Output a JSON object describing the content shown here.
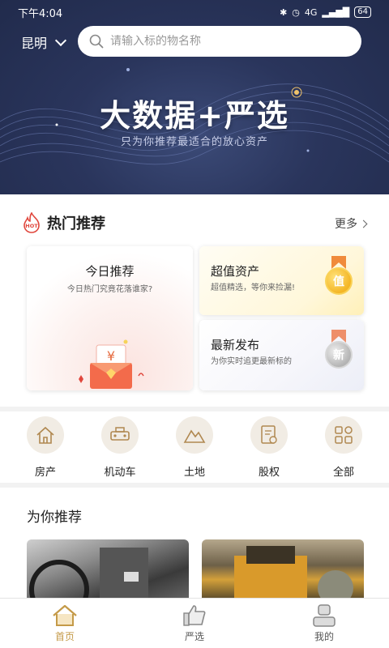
{
  "status_bar": {
    "time": "下午4:04",
    "network": "4G",
    "battery": "64"
  },
  "header": {
    "city": "昆明",
    "search_placeholder": "请输入标的物名称"
  },
  "banner": {
    "title": "大数据+严选",
    "subtitle": "只为你推荐最适合的放心资产"
  },
  "hot": {
    "badge": "HOT",
    "title": "热门推荐",
    "more_label": "更多",
    "today": {
      "title": "今日推荐",
      "subtitle": "今日热门究竟花落谁家?"
    },
    "value": {
      "title": "超值资产",
      "subtitle": "超值精选，等你来捡漏!",
      "medal": "值"
    },
    "new": {
      "title": "最新发布",
      "subtitle": "为你实时追更最新标的",
      "medal": "新"
    }
  },
  "categories": [
    {
      "label": "房产",
      "icon": "house-icon"
    },
    {
      "label": "机动车",
      "icon": "car-icon"
    },
    {
      "label": "土地",
      "icon": "mountain-icon"
    },
    {
      "label": "股权",
      "icon": "certificate-icon"
    },
    {
      "label": "全部",
      "icon": "grid-icon"
    }
  ],
  "recommend": {
    "title": "为你推荐"
  },
  "tabs": [
    {
      "label": "首页",
      "icon": "home-icon",
      "active": true
    },
    {
      "label": "严选",
      "icon": "thumbs-up-icon",
      "active": false
    },
    {
      "label": "我的",
      "icon": "user-icon",
      "active": false
    }
  ],
  "colors": {
    "hero_bg": "#243053",
    "accent_gold": "#c49a48",
    "hot_red": "#e0463c"
  }
}
